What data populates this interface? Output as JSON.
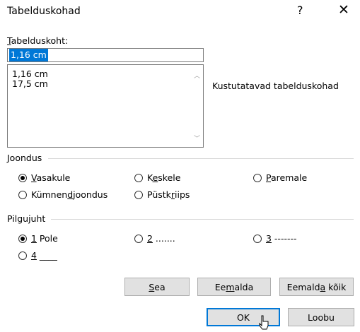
{
  "window": {
    "title": "Tabelduskohad",
    "help": "?",
    "close": "✕"
  },
  "tab_position": {
    "label_u": "T",
    "label_rest": "abelduskoht:",
    "value": "1,16 cm",
    "list": [
      "1,16 cm",
      "17,5 cm"
    ]
  },
  "clear_label": "Kustutatavad tabelduskohad",
  "alignment": {
    "label": "Joondus",
    "options": [
      {
        "u": "V",
        "rest": "asakule",
        "checked": true
      },
      {
        "pre": "K",
        "u": "e",
        "rest": "skele",
        "checked": false
      },
      {
        "u": "P",
        "rest": "aremale",
        "checked": false
      },
      {
        "pre": "Kümnen",
        "u": "d",
        "rest": "joondus",
        "checked": false
      },
      {
        "pre": "Püstk",
        "u": "r",
        "rest": "iips",
        "checked": false
      }
    ]
  },
  "leader": {
    "label": "Pilgujuht",
    "options": [
      {
        "u": "1",
        "rest": " Pole",
        "checked": true
      },
      {
        "u": "2",
        "rest": " .......",
        "checked": false
      },
      {
        "u": "3",
        "rest": " -------",
        "checked": false
      },
      {
        "u": "4",
        "rest": " ____",
        "checked": false
      }
    ]
  },
  "buttons": {
    "set": {
      "u": "S",
      "rest": "ea"
    },
    "clear": {
      "pre": "Ee",
      "u": "m",
      "rest": "alda"
    },
    "clear_all": {
      "pre": "Eemald",
      "u": "a",
      "rest": " kõik"
    },
    "ok": "OK",
    "cancel": "Loobu"
  }
}
